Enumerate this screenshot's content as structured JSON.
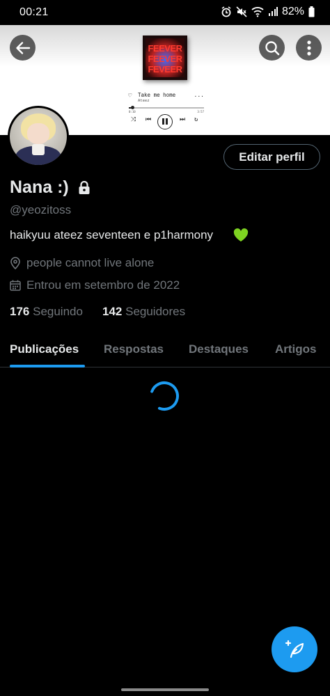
{
  "status_bar": {
    "time": "00:21",
    "battery": "82%"
  },
  "banner": {
    "album_words": [
      "FEEVER",
      "FEEVER",
      "FEVEER"
    ],
    "song_title": "Take me home",
    "song_artist": "Ateez",
    "song_more": "...",
    "time_elapsed": "0:10",
    "time_total": "3:57",
    "progress": 0.05
  },
  "header": {
    "back_icon": "arrow-left-icon",
    "search_icon": "search-icon",
    "more_icon": "more-vertical-icon"
  },
  "profile": {
    "edit_label": "Editar perfil",
    "name": "Nana :)",
    "handle": "@yeozitoss",
    "bio": "haikyuu ateez seventeen e p1harmony",
    "bio_emoji": "green-heart-icon",
    "location": "people cannot live alone",
    "joined": "Entrou em setembro de 2022",
    "following_count": "176",
    "following_label": "Seguindo",
    "followers_count": "142",
    "followers_label": "Seguidores"
  },
  "tabs": [
    {
      "label": "Publicações",
      "active": true
    },
    {
      "label": "Respostas",
      "active": false
    },
    {
      "label": "Destaques",
      "active": false
    },
    {
      "label": "Artigos",
      "active": false
    }
  ],
  "colors": {
    "accent": "#1d9bf0",
    "background": "#000000",
    "muted_text": "#71767b",
    "primary_text": "#e7e9ea"
  },
  "fab": {
    "icon": "compose-feather-icon"
  }
}
